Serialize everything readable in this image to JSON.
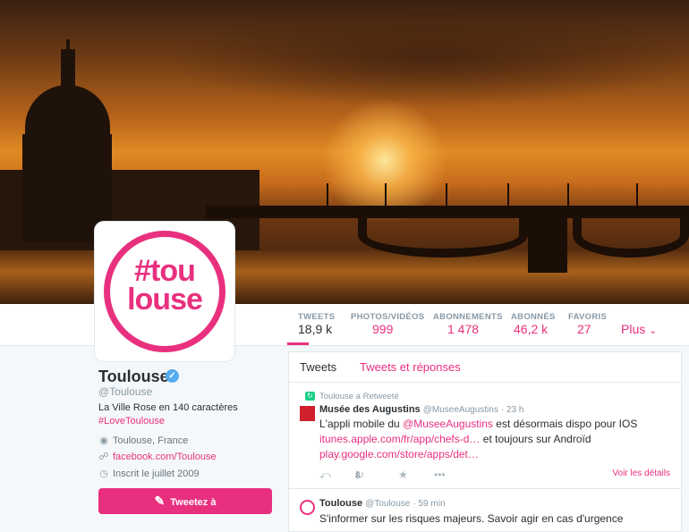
{
  "profile": {
    "avatar_text": "#tou\nlouse",
    "name": "Toulouse",
    "handle": "@Toulouse",
    "bio": "La Ville Rose en 140 caractères",
    "hashtag": "#LoveToulouse",
    "location": "Toulouse, France",
    "website": "facebook.com/Toulouse",
    "joined": "Inscrit le juillet 2009",
    "tweet_button": "Tweetez à",
    "icons": {
      "location": "location-pin-icon",
      "website": "link-icon",
      "joined": "calendar-icon",
      "tweet_button": "compose-icon",
      "verified": "verified-badge-icon"
    }
  },
  "stats": [
    {
      "label": "TWEETS",
      "value": "18,9 k"
    },
    {
      "label": "PHOTOS/VIDÉOS",
      "value": "999"
    },
    {
      "label": "ABONNEMENTS",
      "value": "1 478"
    },
    {
      "label": "ABONNÉS",
      "value": "46,2 k"
    },
    {
      "label": "FAVORIS",
      "value": "27"
    }
  ],
  "more_label": "Plus",
  "timeline": {
    "tabs": [
      "Tweets",
      "Tweets et réponses"
    ],
    "tweets": [
      {
        "retweet_note": "Toulouse a Retweeté",
        "author": "Musée des Augustins",
        "handle": "@MuseeAugustins",
        "time": "23 h",
        "line1_pre": "L'appli mobile du ",
        "line1_mention": "@MuseeAugustins",
        "line1_post": " est désormais dispo pour IOS",
        "line2_link": "itunes.apple.com/fr/app/chefs-d…",
        "line2_post": " et toujours sur Androïd",
        "line3_link": "play.google.com/store/apps/det…",
        "retweet_count": "8",
        "details": "Voir les détails"
      },
      {
        "author": "Toulouse",
        "handle": "@Toulouse",
        "time": "59 min",
        "text": "S'informer sur les risques majeurs. Savoir agir en cas d'urgence"
      }
    ]
  },
  "colors": {
    "accent": "#e8307e",
    "muted": "#8899a6",
    "verified": "#55acee",
    "retweet": "#19cf86"
  }
}
